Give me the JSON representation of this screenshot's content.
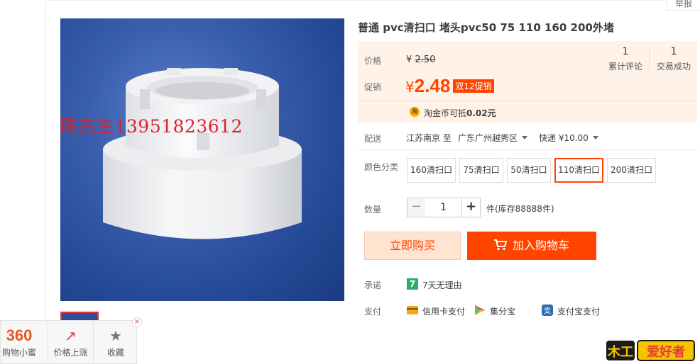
{
  "report_label": "举报",
  "product": {
    "title": "普通 pvc清扫口 堵头pvc50 75 110 160 200外堵",
    "watermark": "陈先生13951823612"
  },
  "price": {
    "label": "价格",
    "currency": "¥",
    "original": "2.50",
    "promo_label": "促销",
    "promo_value": "2.48",
    "promo_tag": "双12促销"
  },
  "stats": {
    "reviews_count": "1",
    "reviews_label": "累计评论",
    "deals_count": "1",
    "deals_label": "交易成功"
  },
  "coin": {
    "icon": "淘",
    "text_prefix": "淘金币可抵",
    "amount": "0.02元"
  },
  "shipping": {
    "label": "配送",
    "from": "江苏南京 至",
    "to": "广东广州越秀区",
    "method": "快递 ¥10.00"
  },
  "sku": {
    "label": "颜色分类",
    "options": [
      "160清扫口",
      "75清扫口",
      "50清扫口",
      "110清扫口",
      "200清扫口"
    ],
    "selected_index": 3
  },
  "quantity": {
    "label": "数量",
    "minus": "−",
    "value": "1",
    "plus": "+",
    "stock_text": "件(库存88888件)"
  },
  "buttons": {
    "buy_now": "立即购买",
    "add_cart": "加入购物车"
  },
  "promise": {
    "label": "承诺",
    "icon_text": "7",
    "text": "7天无理由"
  },
  "payment": {
    "label": "支付",
    "methods": [
      "信用卡支付",
      "集分宝",
      "支付宝支付"
    ]
  },
  "float_bar": {
    "brand": "360",
    "brand_label": "购物小蜜",
    "price_up_label": "价格上涨",
    "favorite_label": "收藏",
    "close": "×"
  },
  "badge": {
    "left": "木工",
    "right": "爱好者"
  },
  "colors": {
    "accent": "#ff4400",
    "price_bg": "#fff2e8",
    "image_bg": "#2f569f"
  }
}
